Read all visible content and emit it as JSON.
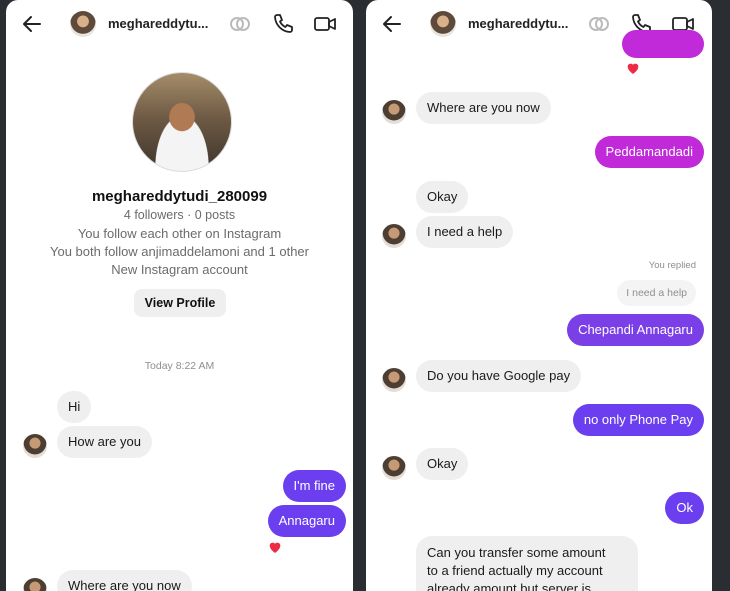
{
  "colors": {
    "outgoing_magenta": "#c02ad9",
    "outgoing_purple": "#6b3ff0",
    "incoming_gray": "#efefef",
    "heart": "#ed2b44"
  },
  "left_panel": {
    "header": {
      "username": "meghareddytu...",
      "icons": [
        "back-arrow-icon",
        "activity-rings-icon",
        "phone-icon",
        "video-icon"
      ]
    },
    "profile": {
      "username": "meghareddytudi_280099",
      "stats": "4 followers · 0 posts",
      "line1": "You follow each other on Instagram",
      "line2": "You both follow anjimaddelamoni and 1 other",
      "line3": "New Instagram account",
      "view_profile": "View Profile"
    },
    "timestamp": "Today 8:22 AM",
    "messages": [
      {
        "dir": "in",
        "text": "Hi"
      },
      {
        "dir": "in",
        "text": "How are you"
      },
      {
        "dir": "out",
        "text": "I'm fine"
      },
      {
        "dir": "out",
        "text": "Annagaru",
        "reaction": "heart"
      },
      {
        "dir": "in",
        "text": "Where are you now"
      }
    ]
  },
  "right_panel": {
    "header": {
      "username": "meghareddytu...",
      "icons": [
        "back-arrow-icon",
        "activity-rings-icon",
        "phone-icon",
        "video-icon"
      ]
    },
    "messages": [
      {
        "dir": "in",
        "text": "Where are you now"
      },
      {
        "dir": "out",
        "text": "Peddamandadi"
      },
      {
        "dir": "in",
        "text": "Okay"
      },
      {
        "dir": "in",
        "text": "I need a help"
      },
      {
        "dir": "out",
        "text": "Chepandi Annagaru",
        "replied_label": "You replied",
        "replied_quote": "I need a help"
      },
      {
        "dir": "in",
        "text": "Do you have Google pay"
      },
      {
        "dir": "out",
        "text": "no only Phone Pay"
      },
      {
        "dir": "in",
        "text": "Okay"
      },
      {
        "dir": "out",
        "text": "Ok"
      },
      {
        "dir": "in",
        "lines": [
          "Can you transfer some amount",
          "to a friend actually my account",
          "already amount but server is"
        ]
      }
    ]
  }
}
